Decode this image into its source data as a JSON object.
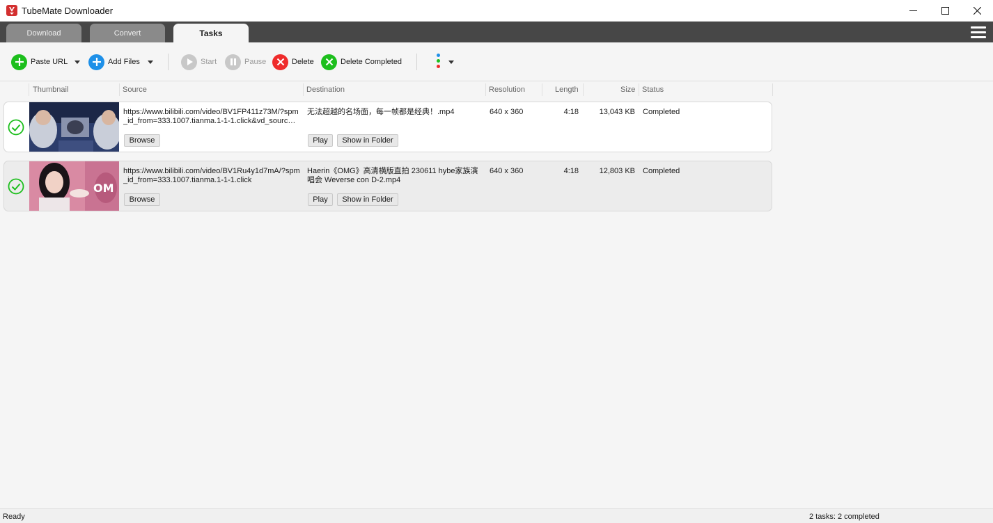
{
  "window": {
    "title": "TubeMate Downloader",
    "icon": "tubemate-logo-icon"
  },
  "tabs": [
    {
      "label": "Download",
      "active": false
    },
    {
      "label": "Convert",
      "active": false
    },
    {
      "label": "Tasks",
      "active": true
    }
  ],
  "toolbar": {
    "paste_url": "Paste URL",
    "add_files": "Add Files",
    "start": "Start",
    "pause": "Pause",
    "delete": "Delete",
    "delete_completed": "Delete Completed"
  },
  "columns": {
    "thumbnail": "Thumbnail",
    "source": "Source",
    "destination": "Destination",
    "resolution": "Resolution",
    "length": "Length",
    "size": "Size",
    "status": "Status"
  },
  "tasks": [
    {
      "source": "https://www.bilibili.com/video/BV1FP411z73M/?spm_id_from=333.1007.tianma.1-1-1.click&vd_sourc…",
      "destination": "无法超越的名场面，每一帧都是经典！.mp4",
      "resolution": "640 x 360",
      "length": "4:18",
      "size": "13,043 KB",
      "status": "Completed",
      "browse_label": "Browse",
      "play_label": "Play",
      "folder_label": "Show in Folder"
    },
    {
      "source": "https://www.bilibili.com/video/BV1Ru4y1d7mA/?spm_id_from=333.1007.tianma.1-1-1.click",
      "destination": "Haerin《OMG》高清横版直拍 230611 hybe家族演唱会 Weverse con D-2.mp4",
      "resolution": "640 x 360",
      "length": "4:18",
      "size": "12,803 KB",
      "status": "Completed",
      "browse_label": "Browse",
      "play_label": "Play",
      "folder_label": "Show in Folder"
    }
  ],
  "statusbar": {
    "left": "Ready",
    "right": "2 tasks: 2 completed"
  },
  "colors": {
    "tabbar_bg": "#474747",
    "accent_green": "#1dbf1d",
    "accent_blue": "#1e90e8",
    "accent_red": "#ef2b2b",
    "logo_red": "#d32f2f"
  }
}
